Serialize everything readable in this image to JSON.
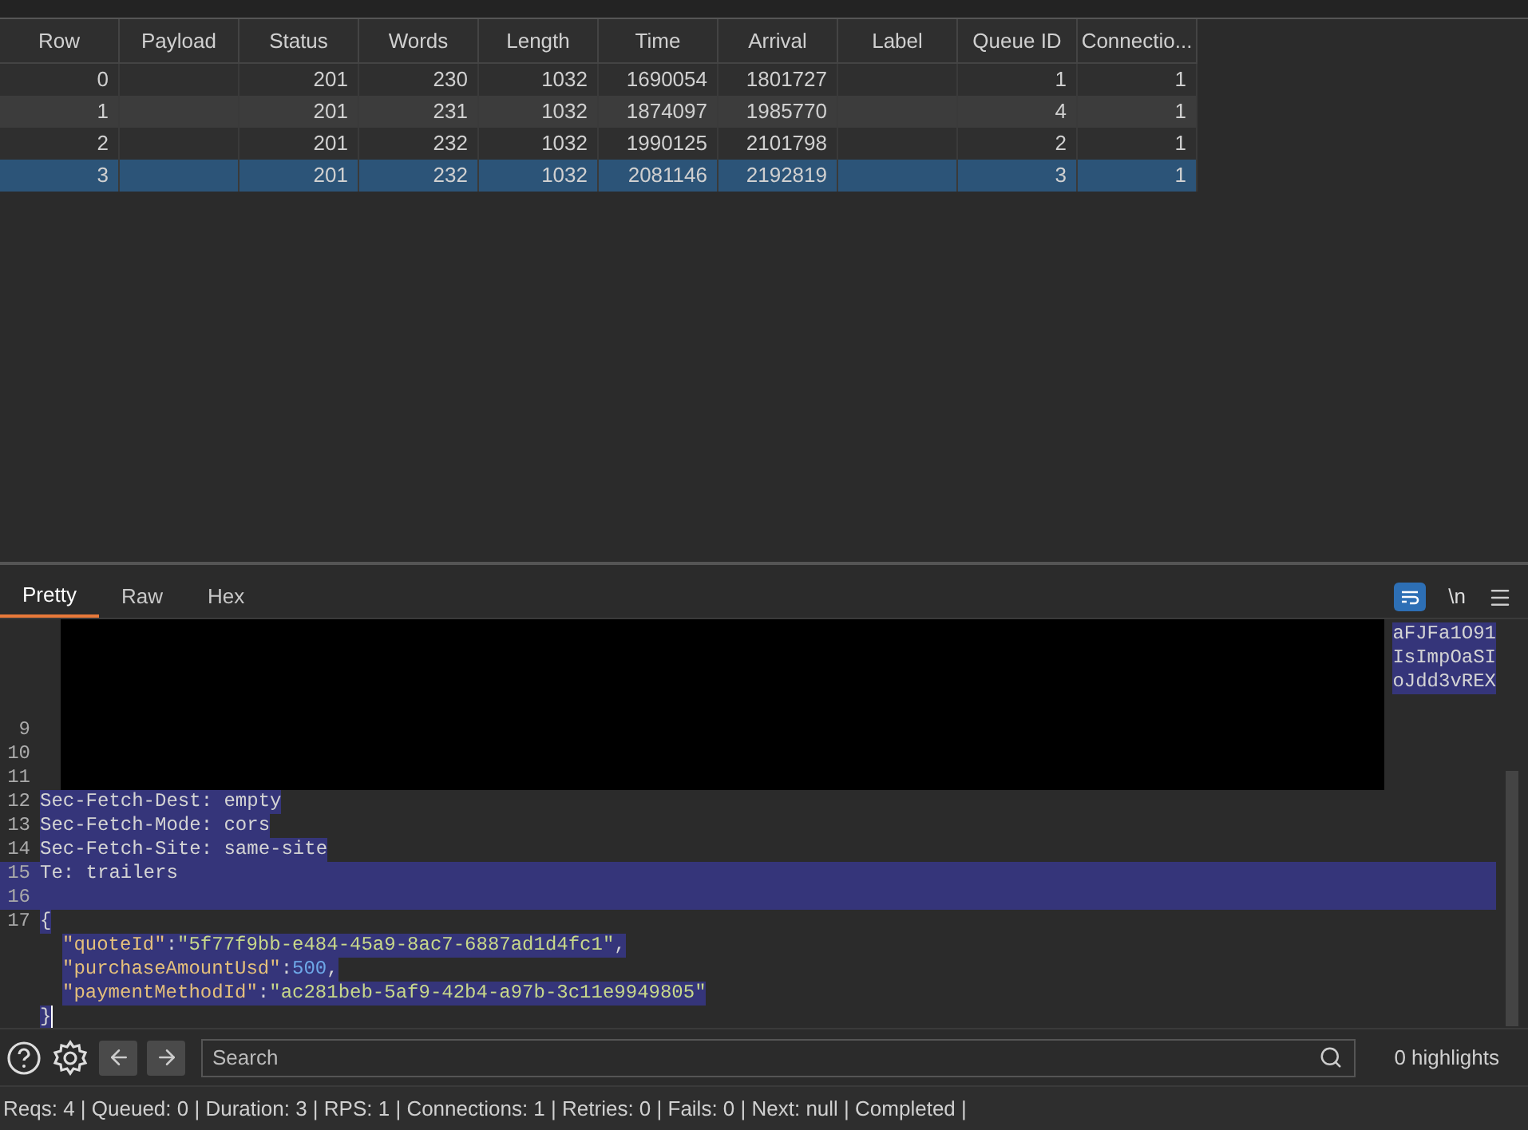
{
  "table": {
    "columns": [
      "Row",
      "Payload",
      "Status",
      "Words",
      "Length",
      "Time",
      "Arrival",
      "Label",
      "Queue ID",
      "Connectio..."
    ],
    "rows": [
      {
        "cells": [
          "0",
          null,
          "201",
          "230",
          "1032",
          "1690054",
          "1801727",
          null,
          "1",
          "1"
        ],
        "selected": false
      },
      {
        "cells": [
          "1",
          null,
          "201",
          "231",
          "1032",
          "1874097",
          "1985770",
          null,
          "4",
          "1"
        ],
        "selected": false
      },
      {
        "cells": [
          "2",
          null,
          "201",
          "232",
          "1032",
          "1990125",
          "2101798",
          null,
          "2",
          "1"
        ],
        "selected": false
      },
      {
        "cells": [
          "3",
          null,
          "201",
          "232",
          "1032",
          "2081146",
          "2192819",
          null,
          "3",
          "1"
        ],
        "selected": true
      }
    ]
  },
  "tabs": [
    {
      "label": "Pretty",
      "selected": true
    },
    {
      "label": "Raw",
      "selected": false
    },
    {
      "label": "Hex",
      "selected": false
    }
  ],
  "toolbar": {
    "wrap_on": true,
    "newline_label": "\\n"
  },
  "editor": {
    "lines": [
      {
        "tail": "aFJFa1O91",
        "full_line": false
      },
      {
        "tail": "IsImpOaSI",
        "full_line": false
      },
      {
        "tail": "oJdd3vREX",
        "full_line": false
      },
      {
        "full_line": false
      },
      {
        "number": "9",
        "full_line": false
      },
      {
        "number": "10",
        "full_line": false
      },
      {
        "number": "11",
        "full_line": false
      },
      {
        "number": "12",
        "full_line": false,
        "segments": [
          {
            "kind": "plain",
            "text": "Sec-Fetch-Dest: empty"
          }
        ]
      },
      {
        "number": "13",
        "full_line": false,
        "segments": [
          {
            "kind": "plain",
            "text": "Sec-Fetch-Mode: cors"
          }
        ]
      },
      {
        "number": "14",
        "full_line": false,
        "segments": [
          {
            "kind": "plain",
            "text": "Sec-Fetch-Site: same-site"
          }
        ]
      },
      {
        "number": "15",
        "full_line": true,
        "segments": [
          {
            "kind": "plain",
            "text": "Te: trailers"
          }
        ]
      },
      {
        "number": "16",
        "full_line": true
      },
      {
        "number": "17",
        "full_line": false,
        "segments": [
          {
            "kind": "plain",
            "text": "{"
          }
        ]
      },
      {
        "full_line": false,
        "indent": true,
        "segments": [
          {
            "kind": "key",
            "text": "\"quoteId\""
          },
          {
            "kind": "plain",
            "text": ":"
          },
          {
            "kind": "string",
            "text": "\"5f77f9bb-e484-45a9-8ac7-6887ad1d4fc1\""
          },
          {
            "kind": "plain",
            "text": ","
          }
        ]
      },
      {
        "full_line": false,
        "indent": true,
        "segments": [
          {
            "kind": "key",
            "text": "\"purchaseAmountUsd\""
          },
          {
            "kind": "plain",
            "text": ":"
          },
          {
            "kind": "number",
            "text": "500"
          },
          {
            "kind": "plain",
            "text": ","
          }
        ]
      },
      {
        "full_line": false,
        "indent": true,
        "segments": [
          {
            "kind": "key",
            "text": "\"paymentMethodId\""
          },
          {
            "kind": "plain",
            "text": ":"
          },
          {
            "kind": "string",
            "text": "\"ac281beb-5af9-42b4-a97b-3c11e9949805\""
          }
        ]
      },
      {
        "full_line": false,
        "caret": true,
        "segments": [
          {
            "kind": "plain",
            "text": "}"
          }
        ]
      }
    ]
  },
  "search": {
    "placeholder": "Search",
    "highlights": "0 highlights"
  },
  "status_bar": "Reqs: 4 | Queued: 0 | Duration: 3 | RPS: 1 | Connections: 1 | Retries: 0 | Fails: 0 | Next: null | Completed |"
}
